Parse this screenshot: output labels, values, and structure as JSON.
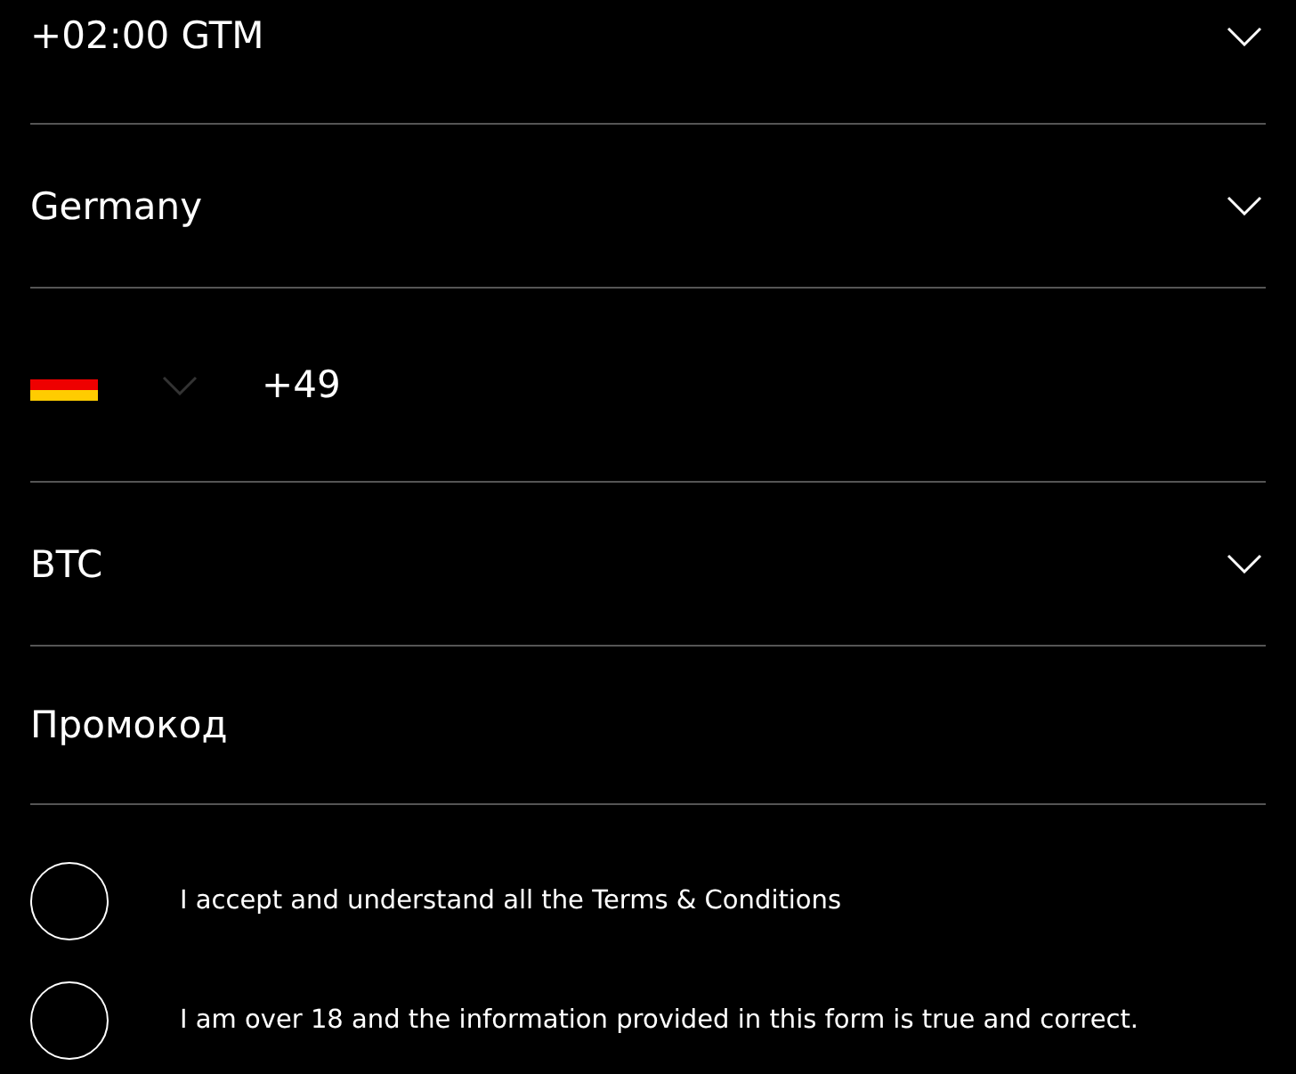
{
  "fields": [
    {
      "kind": "select",
      "value": "+02:00 GTM"
    },
    {
      "kind": "select",
      "value": "Germany"
    },
    {
      "kind": "phone",
      "code": "+49"
    },
    {
      "kind": "select",
      "value": "BTC"
    },
    {
      "kind": "input",
      "placeholder": "Промокод"
    }
  ],
  "agreements": [
    {
      "label": "I accept and understand all the Terms & Conditions",
      "checked": false
    },
    {
      "label": "I am over 18 and the information provided in this form is true and correct.",
      "checked": false
    }
  ]
}
